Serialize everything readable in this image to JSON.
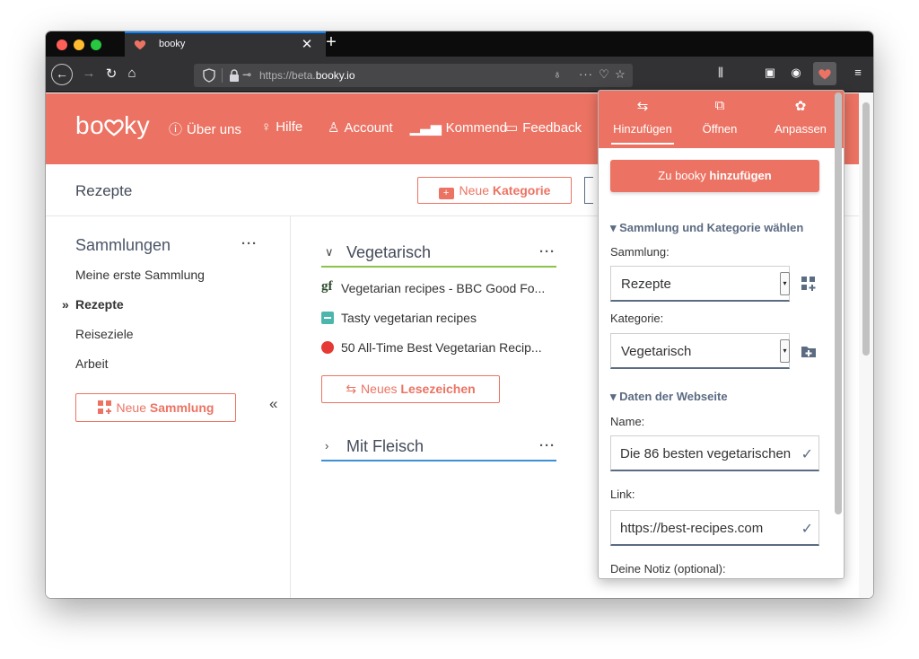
{
  "browser": {
    "tab": {
      "title": "booky",
      "favicon": "heart-icon"
    },
    "url": {
      "prefix": "https://beta.",
      "domain": "booky.io"
    },
    "accent_color": "#0a84ff"
  },
  "app": {
    "brand": "booky",
    "brand_color": "#ec7363",
    "nav": [
      {
        "label": "Über uns",
        "icon": "info-icon"
      },
      {
        "label": "Hilfe",
        "icon": "lightbulb-icon"
      },
      {
        "label": "Account",
        "icon": "user-icon"
      },
      {
        "label": "Kommend",
        "icon": "bar-chart-icon"
      },
      {
        "label": "Feedback",
        "icon": "chat-icon"
      }
    ],
    "page_title": "Rezepte",
    "new_category": {
      "prefix": "Neue",
      "bold": "Kategorie"
    },
    "sidebar": {
      "title": "Sammlungen",
      "items": [
        "Meine erste Sammlung",
        "Rezepte",
        "Reiseziele",
        "Arbeit"
      ],
      "active_marker": "»",
      "new_collection": {
        "prefix": "Neue",
        "bold": "Sammlung"
      },
      "collapse_symbol": "«"
    },
    "categories": [
      {
        "name": "Vegetarisch",
        "expanded": true,
        "color": "#8bc34a",
        "bookmarks": [
          {
            "title": "Vegetarian recipes - BBC Good Fo...",
            "icon": "gf"
          },
          {
            "title": "Tasty vegetarian recipes",
            "icon": "tasty"
          },
          {
            "title": "50 All-Time Best Vegetarian Recip...",
            "icon": "food"
          }
        ],
        "new_bookmark": {
          "prefix": "Neues",
          "bold": "Lesezeichen"
        }
      },
      {
        "name": "Mit Fleisch",
        "expanded": false,
        "color": "#3d8fd6"
      }
    ]
  },
  "popup": {
    "tabs": [
      {
        "label": "Hinzufügen",
        "icon": "add-link-icon",
        "active": true
      },
      {
        "label": "Öffnen",
        "icon": "open-external-icon",
        "active": false
      },
      {
        "label": "Anpassen",
        "icon": "palette-icon",
        "active": false
      }
    ],
    "primary_button": {
      "prefix": "Zu booky",
      "bold": "hinzufügen"
    },
    "section_collection": "Sammlung und Kategorie wählen",
    "collection_label": "Sammlung:",
    "collection_value": "Rezepte",
    "category_label": "Kategorie:",
    "category_value": "Vegetarisch",
    "section_website": "Daten der Webseite",
    "name_label": "Name:",
    "name_value": "Die 86 besten vegetarischen",
    "link_label": "Link:",
    "link_value": "https://best-recipes.com",
    "note_label": "Deine Notiz (optional):"
  }
}
